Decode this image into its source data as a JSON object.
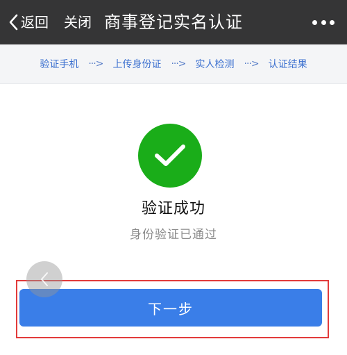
{
  "navbar": {
    "back_label": "返回",
    "close_label": "关闭",
    "title": "商事登记实名认证"
  },
  "steps": [
    {
      "label": "验证手机"
    },
    {
      "label": "上传身份证"
    },
    {
      "label": "实人检测"
    },
    {
      "label": "认证结果"
    }
  ],
  "steps_arrow": "···>",
  "result": {
    "title": "验证成功",
    "description": "身份验证已通过"
  },
  "actions": {
    "next_label": "下一步"
  },
  "colors": {
    "navbar_bg": "#353536",
    "step_text": "#3a6fcf",
    "success": "#1aad19",
    "primary_button": "#3a7ee8",
    "highlight_frame": "#e23b3b"
  },
  "icons": {
    "back": "chevron-left-icon",
    "more": "more-dots-icon",
    "success": "checkmark-icon",
    "float_back": "chevron-left-icon"
  }
}
